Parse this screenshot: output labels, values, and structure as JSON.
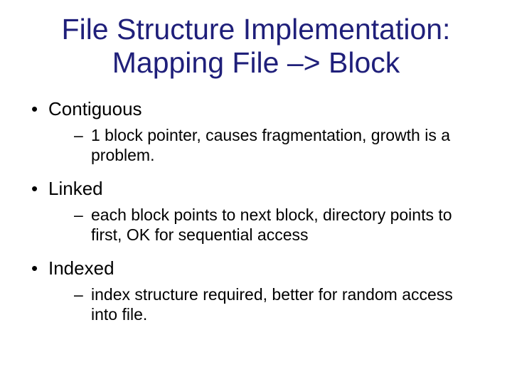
{
  "title": "File Structure Implementation: Mapping File –> Block",
  "items": [
    {
      "label": "Contiguous",
      "detail": "1 block pointer, causes fragmentation, growth is a problem."
    },
    {
      "label": "Linked",
      "detail": "each block points to next block, directory points to first, OK for sequential access"
    },
    {
      "label": "Indexed",
      "detail": "index structure required, better for random access into file."
    }
  ]
}
